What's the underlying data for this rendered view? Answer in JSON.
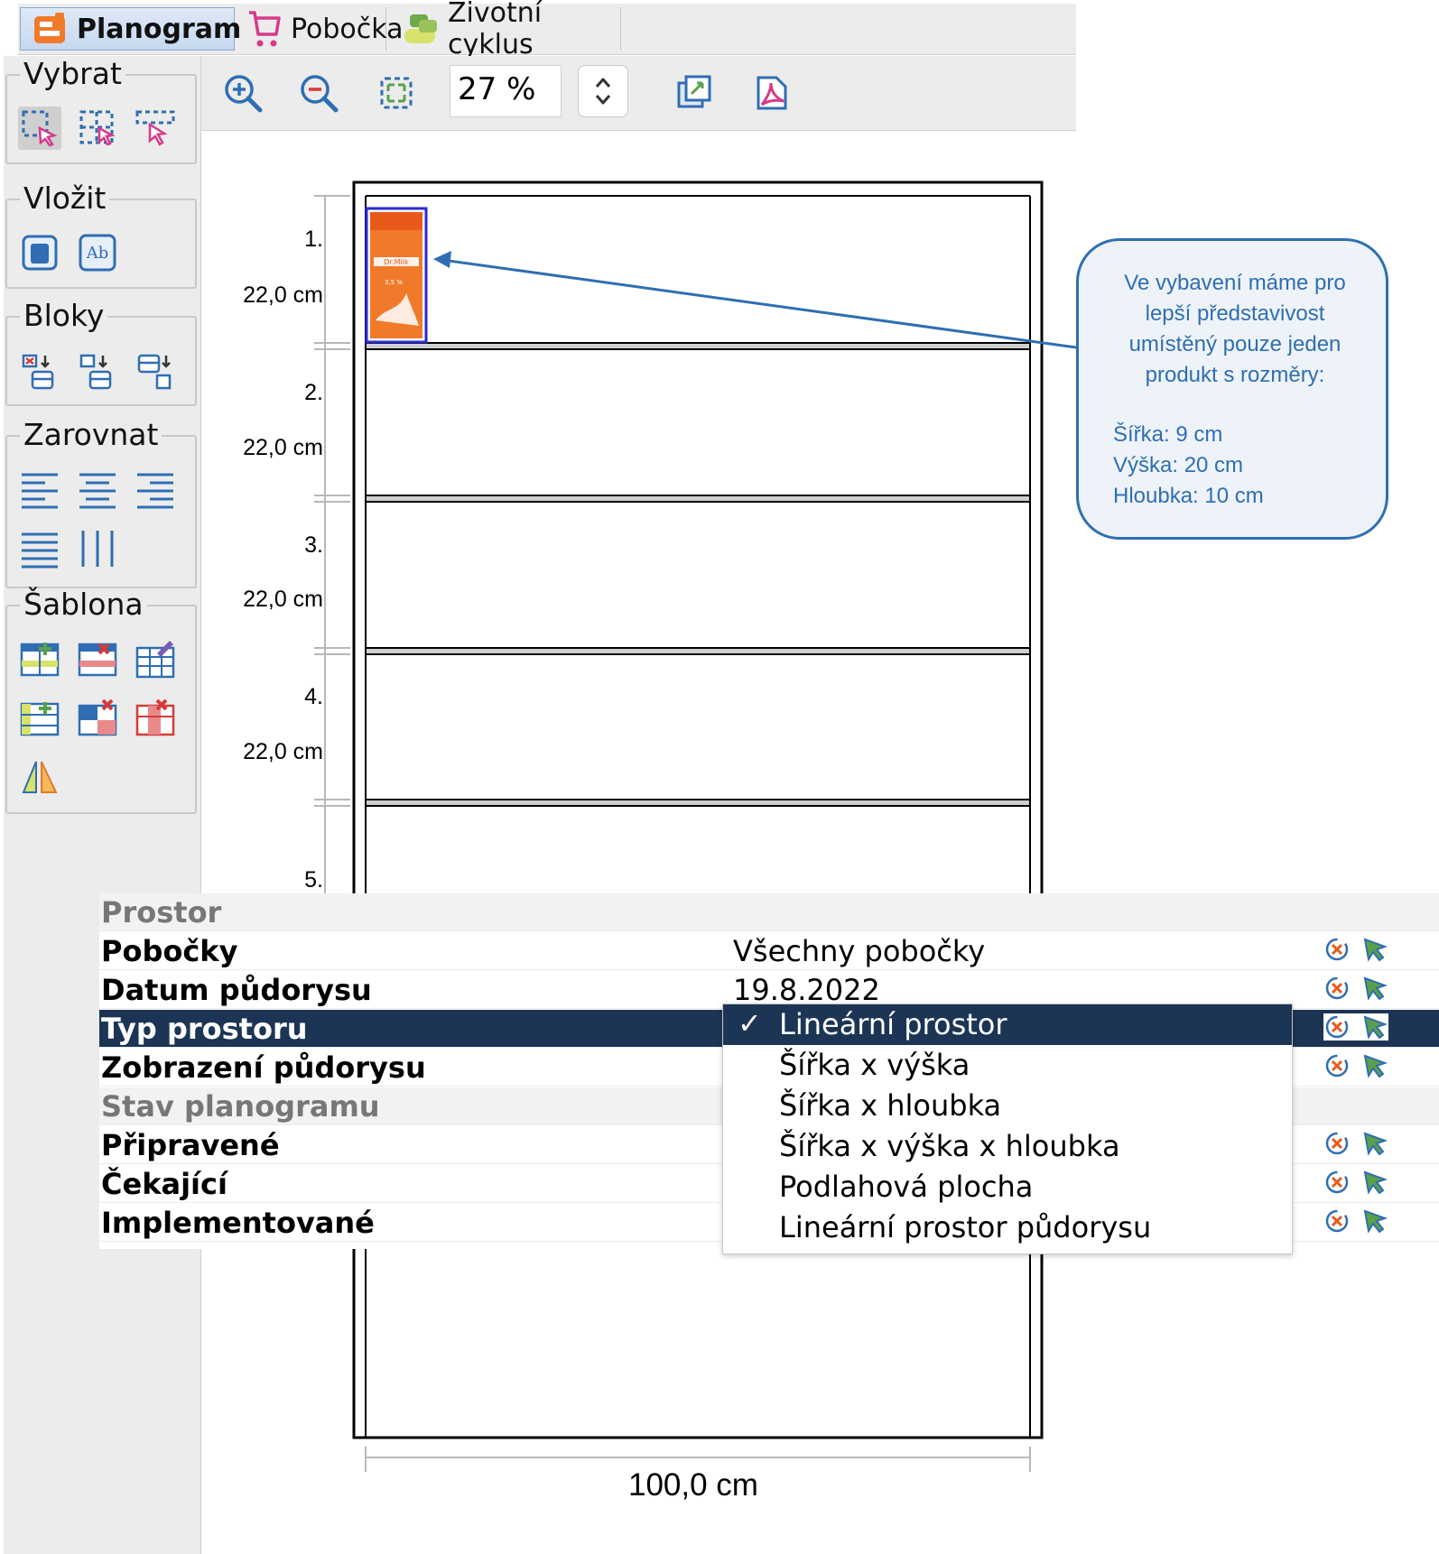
{
  "tabs": [
    {
      "label": "Planogram",
      "icon": "planogram-icon",
      "active": true
    },
    {
      "label": "Pobočka",
      "icon": "cart-icon",
      "active": false
    },
    {
      "label": "Životní cyklus",
      "icon": "lifecycle-icon",
      "active": false
    }
  ],
  "toolbar": {
    "zoom_in_icon": "zoom-in-icon",
    "zoom_out_icon": "zoom-out-icon",
    "fit_icon": "fit-to-screen-icon",
    "zoom_value": "27 %",
    "export_image_icon": "export-image-icon",
    "export_pdf_icon": "pdf-icon"
  },
  "palette": {
    "groups": [
      {
        "label": "Vybrat"
      },
      {
        "label": "Vložit"
      },
      {
        "label": "Bloky"
      },
      {
        "label": "Zarovnat"
      },
      {
        "label": "Šablona"
      }
    ]
  },
  "planogram": {
    "shelves": [
      {
        "number": "1.",
        "height": "22,0 cm"
      },
      {
        "number": "2.",
        "height": "22,0 cm"
      },
      {
        "number": "3.",
        "height": "22,0 cm"
      },
      {
        "number": "4.",
        "height": "22,0 cm"
      },
      {
        "number": "5.",
        "height": ""
      }
    ],
    "width_label": "100,0 cm",
    "product": {
      "brand": "Dr.Milk",
      "fat": "3,5 %"
    }
  },
  "callout": {
    "line1": "Ve vybavení máme pro",
    "line2": "lepší představivost",
    "line3": "umístěný pouze jeden",
    "line4": "produkt s rozměry:",
    "width": "Šířka: 9 cm",
    "height": "Výška: 20 cm",
    "depth": "Hloubka: 10 cm"
  },
  "properties": {
    "section_space": "Prostor",
    "branches_label": "Pobočky",
    "branches_value": "Všechny pobočky",
    "date_label": "Datum půdorysu",
    "date_value": "19.8.2022",
    "space_type_label": "Typ prostoru",
    "floorplan_view_label": "Zobrazení půdorysu",
    "section_state": "Stav planogramu",
    "prepared_label": "Připravené",
    "waiting_label": "Čekající",
    "implemented_label": "Implementované"
  },
  "dropdown": {
    "check": "✓",
    "options": [
      "Lineární prostor",
      "Šířka x výška",
      "Šířka x hloubka",
      "Šířka x výška x hloubka",
      "Podlahová plocha",
      "Lineární prostor půdorysu"
    ],
    "selected_index": 0
  },
  "colors": {
    "selection_dark": "#1d3555",
    "callout_blue": "#2f6eb2",
    "product_orange": "#f07a2a"
  }
}
